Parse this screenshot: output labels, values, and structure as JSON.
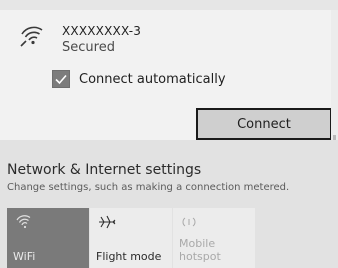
{
  "network": {
    "ssid": "XXXXXXXX-3",
    "status": "Secured",
    "auto_connect_label": "Connect automatically",
    "auto_connect_checked": true,
    "connect_label": "Connect",
    "signal_icon": "wifi-signal-icon"
  },
  "settings": {
    "title": "Network & Internet settings",
    "subtitle": "Change settings, such as making a connection metered."
  },
  "quick_actions": [
    {
      "label": "WiFi",
      "icon": "wifi-icon",
      "active": true
    },
    {
      "label": "Flight mode",
      "icon": "airplane-icon",
      "active": false
    },
    {
      "label": "Mobile\nhotspot",
      "icon": "hotspot-icon",
      "active": false,
      "disabled": true
    }
  ],
  "colors": {
    "panel_bg": "#f2f2f2",
    "settings_bg": "#e2e2e2",
    "active_tile": "#7a7a7a",
    "button_bg": "#cfcfcf"
  }
}
